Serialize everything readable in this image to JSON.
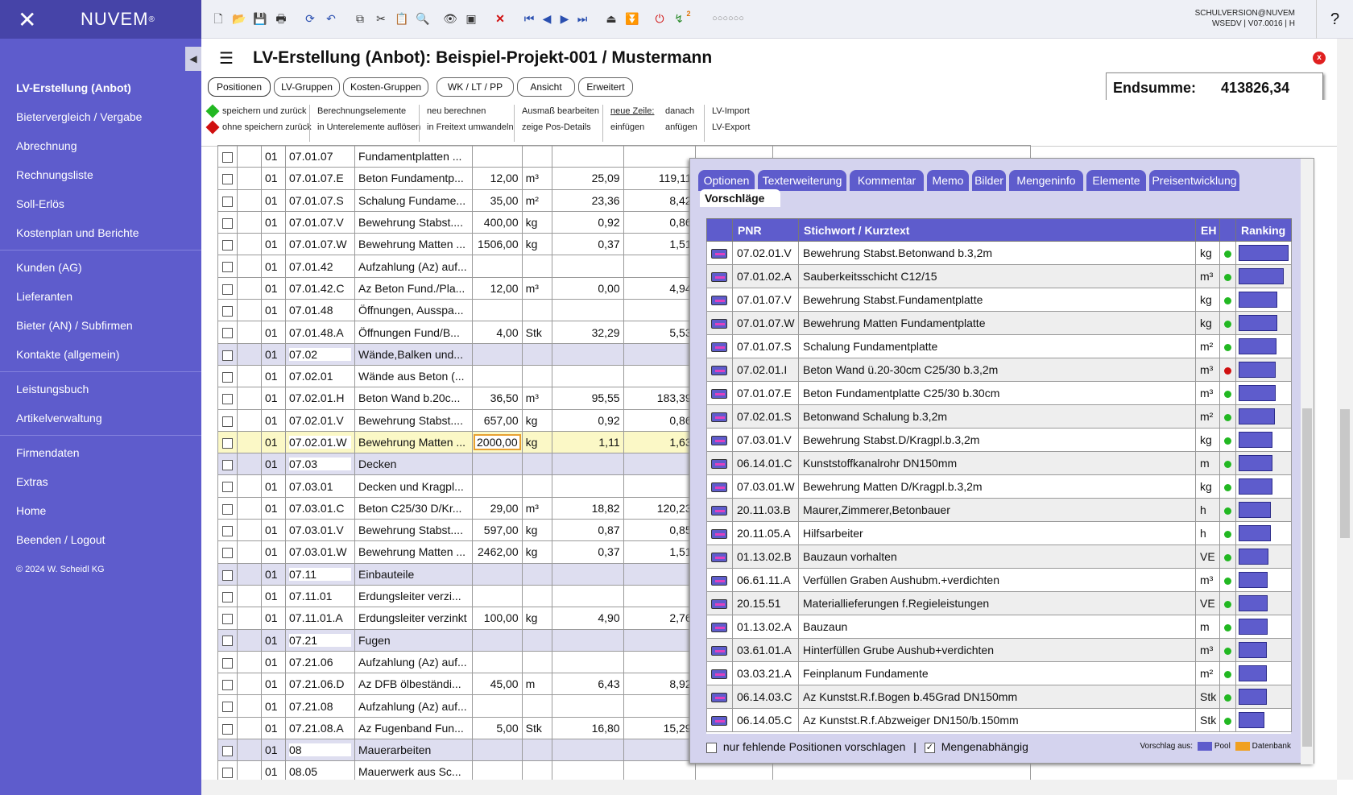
{
  "app": {
    "name": "NUVEM",
    "logo_mark": "✕"
  },
  "user": {
    "line1": "SCHULVERSION@NUVEM",
    "line2": "WSEDV | V07.0016 | H"
  },
  "help": "?",
  "nav": {
    "groups": [
      [
        "LV-Erstellung (Anbot)",
        "Bietervergleich / Vergabe",
        "Abrechnung",
        "Rechnungsliste",
        "Soll-Erlös",
        "Kostenplan und Berichte"
      ],
      [
        "Kunden (AG)",
        "Lieferanten",
        "Bieter (AN) / Subfirmen",
        "Kontakte (allgemein)"
      ],
      [
        "Leistungsbuch",
        "Artikelverwaltung"
      ],
      [
        "Firmendaten",
        "Extras",
        "Home",
        "Beenden / Logout"
      ]
    ],
    "copyright": "© 2024 W. Scheidl KG"
  },
  "toolbar": {
    "pagination_dots": "○○○○○○",
    "badge": "2"
  },
  "title": "LV-Erstellung (Anbot): Beispiel-Projekt-001 / Mustermann",
  "tabs": [
    "Positionen",
    "LV-Gruppen",
    "Kosten-Gruppen",
    "WK / LT / PP",
    "Ansicht",
    "Erweitert"
  ],
  "endsumme": {
    "label": "Endsumme:",
    "value": "413826,34 EUR"
  },
  "commands": {
    "save_back": "speichern und zurück",
    "nosave_back": "ohne speichern zurück",
    "calc1": "Berechnungselemente",
    "calc2": "in Unterelemente auflösen",
    "recalc1": "neu berechnen",
    "recalc2": "in Freitext umwandeln",
    "meas1": "Ausmaß bearbeiten",
    "meas2": "zeige Pos-Details",
    "newrow": "neue Zeile:",
    "insert": "einfügen",
    "after": "danach",
    "append": "anfügen",
    "imp": "LV-Import",
    "exp": "LV-Export"
  },
  "grid_rows": [
    {
      "g": "01",
      "pnr": "07.01.07",
      "text": "Fundamentplatten ...",
      "qty": "",
      "unit": "",
      "ep": "",
      "gp": ""
    },
    {
      "g": "01",
      "pnr": "07.01.07.E",
      "text": "Beton Fundamentp...",
      "qty": "12,00",
      "unit": "m³",
      "ep": "25,09",
      "gp": "119,11"
    },
    {
      "g": "01",
      "pnr": "07.01.07.S",
      "text": "Schalung Fundame...",
      "qty": "35,00",
      "unit": "m²",
      "ep": "23,36",
      "gp": "8,42"
    },
    {
      "g": "01",
      "pnr": "07.01.07.V",
      "text": "Bewehrung Stabst....",
      "qty": "400,00",
      "unit": "kg",
      "ep": "0,92",
      "gp": "0,86"
    },
    {
      "g": "01",
      "pnr": "07.01.07.W",
      "text": "Bewehrung Matten ...",
      "qty": "1506,00",
      "unit": "kg",
      "ep": "0,37",
      "gp": "1,51"
    },
    {
      "g": "01",
      "pnr": "07.01.42",
      "text": "Aufzahlung (Az) auf...",
      "qty": "",
      "unit": "",
      "ep": "",
      "gp": ""
    },
    {
      "g": "01",
      "pnr": "07.01.42.C",
      "text": "Az Beton Fund./Pla...",
      "qty": "12,00",
      "unit": "m³",
      "ep": "0,00",
      "gp": "4,94"
    },
    {
      "g": "01",
      "pnr": "07.01.48",
      "text": "Öffnungen, Ausspa...",
      "qty": "",
      "unit": "",
      "ep": "",
      "gp": ""
    },
    {
      "g": "01",
      "pnr": "07.01.48.A",
      "text": "Öffnungen Fund/B...",
      "qty": "4,00",
      "unit": "Stk",
      "ep": "32,29",
      "gp": "5,53"
    },
    {
      "g": "01",
      "pnr": "07.02",
      "text": "Wände,Balken und...",
      "qty": "",
      "unit": "",
      "ep": "",
      "gp": "",
      "group": true
    },
    {
      "g": "01",
      "pnr": "07.02.01",
      "text": "Wände aus Beton (...",
      "qty": "",
      "unit": "",
      "ep": "",
      "gp": ""
    },
    {
      "g": "01",
      "pnr": "07.02.01.H",
      "text": "Beton Wand b.20c...",
      "qty": "36,50",
      "unit": "m³",
      "ep": "95,55",
      "gp": "183,39"
    },
    {
      "g": "01",
      "pnr": "07.02.01.V",
      "text": "Bewehrung Stabst....",
      "qty": "657,00",
      "unit": "kg",
      "ep": "0,92",
      "gp": "0,86"
    },
    {
      "g": "01",
      "pnr": "07.02.01.W",
      "text": "Bewehrung Matten ...",
      "qty": "2000,00",
      "unit": "kg",
      "ep": "1,11",
      "gp": "1,63",
      "selected": true
    },
    {
      "g": "01",
      "pnr": "07.03",
      "text": "Decken",
      "qty": "",
      "unit": "",
      "ep": "",
      "gp": "",
      "group": true
    },
    {
      "g": "01",
      "pnr": "07.03.01",
      "text": "Decken und Kragpl...",
      "qty": "",
      "unit": "",
      "ep": "",
      "gp": ""
    },
    {
      "g": "01",
      "pnr": "07.03.01.C",
      "text": "Beton C25/30 D/Kr...",
      "qty": "29,00",
      "unit": "m³",
      "ep": "18,82",
      "gp": "120,23"
    },
    {
      "g": "01",
      "pnr": "07.03.01.V",
      "text": "Bewehrung Stabst....",
      "qty": "597,00",
      "unit": "kg",
      "ep": "0,87",
      "gp": "0,85"
    },
    {
      "g": "01",
      "pnr": "07.03.01.W",
      "text": "Bewehrung Matten ...",
      "qty": "2462,00",
      "unit": "kg",
      "ep": "0,37",
      "gp": "1,51"
    },
    {
      "g": "01",
      "pnr": "07.11",
      "text": "Einbauteile",
      "qty": "",
      "unit": "",
      "ep": "",
      "gp": "",
      "group": true
    },
    {
      "g": "01",
      "pnr": "07.11.01",
      "text": "Erdungsleiter verzi...",
      "qty": "",
      "unit": "",
      "ep": "",
      "gp": ""
    },
    {
      "g": "01",
      "pnr": "07.11.01.A",
      "text": "Erdungsleiter verzinkt",
      "qty": "100,00",
      "unit": "kg",
      "ep": "4,90",
      "gp": "2,76"
    },
    {
      "g": "01",
      "pnr": "07.21",
      "text": "Fugen",
      "qty": "",
      "unit": "",
      "ep": "",
      "gp": "",
      "group": true
    },
    {
      "g": "01",
      "pnr": "07.21.06",
      "text": "Aufzahlung (Az) auf...",
      "qty": "",
      "unit": "",
      "ep": "",
      "gp": ""
    },
    {
      "g": "01",
      "pnr": "07.21.06.D",
      "text": "Az DFB ölbeständi...",
      "qty": "45,00",
      "unit": "m",
      "ep": "6,43",
      "gp": "8,92"
    },
    {
      "g": "01",
      "pnr": "07.21.08",
      "text": "Aufzahlung (Az) auf...",
      "qty": "",
      "unit": "",
      "ep": "",
      "gp": ""
    },
    {
      "g": "01",
      "pnr": "07.21.08.A",
      "text": "Az Fugenband Fun...",
      "qty": "5,00",
      "unit": "Stk",
      "ep": "16,80",
      "gp": "15,29"
    },
    {
      "g": "01",
      "pnr": "08",
      "text": "Mauerarbeiten",
      "qty": "",
      "unit": "",
      "ep": "",
      "gp": "",
      "group": true
    },
    {
      "g": "01",
      "pnr": "08.05",
      "text": "Mauerwerk aus Sc...",
      "qty": "",
      "unit": "",
      "ep": "",
      "gp": ""
    }
  ],
  "panel": {
    "tabs": [
      "Optionen",
      "Texterweiterung",
      "Kommentar",
      "Memo",
      "Bilder",
      "Mengeninfo",
      "Elemente",
      "Preisentwicklung"
    ],
    "active_tab": "Vorschläge",
    "headers": {
      "pnr": "PNR",
      "text": "Stichwort / Kurztext",
      "eh": "EH",
      "rank": "Ranking"
    },
    "rows": [
      {
        "pnr": "07.02.01.V",
        "text": "Bewehrung Stabst.Betonwand b.3,2m",
        "eh": "kg",
        "status": "green",
        "rank": 1.0
      },
      {
        "pnr": "07.01.02.A",
        "text": "Sauberkeitsschicht C12/15",
        "eh": "m³",
        "status": "green",
        "rank": 0.9
      },
      {
        "pnr": "07.01.07.V",
        "text": "Bewehrung Stabst.Fundamentplatte",
        "eh": "kg",
        "status": "green",
        "rank": 0.78
      },
      {
        "pnr": "07.01.07.W",
        "text": "Bewehrung Matten Fundamentplatte",
        "eh": "kg",
        "status": "green",
        "rank": 0.78
      },
      {
        "pnr": "07.01.07.S",
        "text": "Schalung Fundamentplatte",
        "eh": "m²",
        "status": "green",
        "rank": 0.76
      },
      {
        "pnr": "07.02.01.I",
        "text": "Beton Wand ü.20-30cm C25/30 b.3,2m",
        "eh": "m³",
        "status": "red",
        "rank": 0.74
      },
      {
        "pnr": "07.01.07.E",
        "text": "Beton Fundamentplatte C25/30 b.30cm",
        "eh": "m³",
        "status": "green",
        "rank": 0.74
      },
      {
        "pnr": "07.02.01.S",
        "text": "Betonwand Schalung b.3,2m",
        "eh": "m²",
        "status": "green",
        "rank": 0.72
      },
      {
        "pnr": "07.03.01.V",
        "text": "Bewehrung Stabst.D/Kragpl.b.3,2m",
        "eh": "kg",
        "status": "green",
        "rank": 0.68
      },
      {
        "pnr": "06.14.01.C",
        "text": "Kunststoffkanalrohr DN150mm",
        "eh": "m",
        "status": "green",
        "rank": 0.68
      },
      {
        "pnr": "07.03.01.W",
        "text": "Bewehrung Matten D/Kragpl.b.3,2m",
        "eh": "kg",
        "status": "green",
        "rank": 0.68
      },
      {
        "pnr": "20.11.03.B",
        "text": "Maurer,Zimmerer,Betonbauer",
        "eh": "h",
        "status": "green",
        "rank": 0.64
      },
      {
        "pnr": "20.11.05.A",
        "text": "Hilfsarbeiter",
        "eh": "h",
        "status": "green",
        "rank": 0.64
      },
      {
        "pnr": "01.13.02.B",
        "text": "Bauzaun vorhalten",
        "eh": "VE",
        "status": "green",
        "rank": 0.6
      },
      {
        "pnr": "06.61.11.A",
        "text": "Verfüllen Graben Aushubm.+verdichten",
        "eh": "m³",
        "status": "green",
        "rank": 0.58
      },
      {
        "pnr": "20.15.51",
        "text": "Materiallieferungen f.Regieleistungen",
        "eh": "VE",
        "status": "green",
        "rank": 0.58
      },
      {
        "pnr": "01.13.02.A",
        "text": "Bauzaun",
        "eh": "m",
        "status": "green",
        "rank": 0.58
      },
      {
        "pnr": "03.61.01.A",
        "text": "Hinterfüllen Grube Aushub+verdichten",
        "eh": "m³",
        "status": "green",
        "rank": 0.56
      },
      {
        "pnr": "03.03.21.A",
        "text": "Feinplanum Fundamente",
        "eh": "m²",
        "status": "green",
        "rank": 0.56
      },
      {
        "pnr": "06.14.03.C",
        "text": "Az Kunstst.R.f.Bogen b.45Grad DN150mm",
        "eh": "Stk",
        "status": "green",
        "rank": 0.56
      },
      {
        "pnr": "06.14.05.C",
        "text": "Az Kunstst.R.f.Abzweiger DN150/b.150mm",
        "eh": "Stk",
        "status": "green",
        "rank": 0.52
      }
    ],
    "footer": {
      "missing_only": "nur fehlende Positionen vorschlagen",
      "sep": "|",
      "qty_dependent": "Mengenabhängig",
      "source_label": "Vorschlag aus:",
      "pool": "Pool",
      "db": "Datenbank"
    },
    "colors": {
      "pool": "#5e5ccc",
      "db": "#f0a020",
      "green": "#22b822",
      "red": "#d01010"
    }
  }
}
